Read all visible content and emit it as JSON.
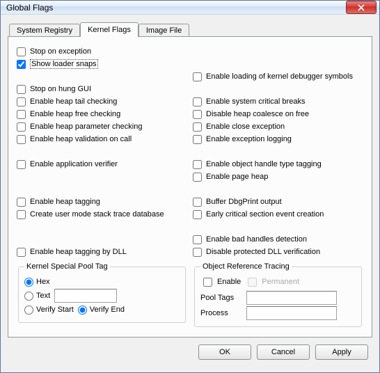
{
  "window": {
    "title": "Global Flags"
  },
  "tabs": {
    "t0": "System Registry",
    "t1": "Kernel Flags",
    "t2": "Image File"
  },
  "left": {
    "stop_exception": "Stop on exception",
    "show_loader_snaps": "Show loader snaps",
    "stop_hung_gui": "Stop on hung GUI",
    "heap_tail": "Enable heap tail checking",
    "heap_free": "Enable heap free checking",
    "heap_param": "Enable heap parameter checking",
    "heap_valid": "Enable heap validation on call",
    "app_verifier": "Enable application verifier",
    "heap_tagging": "Enable heap tagging",
    "user_stack_db": "Create user mode stack trace database",
    "heap_tag_dll": "Enable heap tagging by DLL"
  },
  "right": {
    "kernel_dbg_sym": "Enable loading of kernel debugger symbols",
    "sys_crit_breaks": "Enable system critical breaks",
    "disable_coalesce": "Disable heap coalesce on free",
    "close_exception": "Enable close exception",
    "exception_logging": "Enable exception logging",
    "obj_handle_tag": "Enable object handle type tagging",
    "page_heap": "Enable page heap",
    "buffer_dbgprint": "Buffer DbgPrint output",
    "early_critsec": "Early critical section event creation",
    "bad_handles": "Enable bad handles detection",
    "disable_dll_verif": "Disable protected DLL verification"
  },
  "pooltag": {
    "legend": "Kernel Special Pool Tag",
    "hex": "Hex",
    "text": "Text",
    "verify_start": "Verify Start",
    "verify_end": "Verify End",
    "value": ""
  },
  "ort": {
    "legend": "Object Reference Tracing",
    "enable": "Enable",
    "permanent": "Permanent",
    "pool_tags_label": "Pool Tags",
    "process_label": "Process",
    "pool_tags_value": "",
    "process_value": ""
  },
  "buttons": {
    "ok": "OK",
    "cancel": "Cancel",
    "apply": "Apply"
  }
}
